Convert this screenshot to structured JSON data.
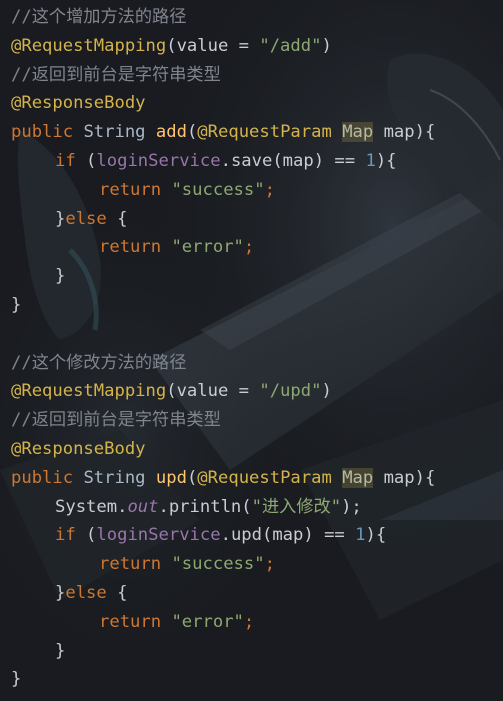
{
  "editor": {
    "lines": [
      {
        "indent": 0,
        "tokens": [
          {
            "t": "//这个增加方法的路径",
            "c": "cm"
          }
        ]
      },
      {
        "indent": 0,
        "tokens": [
          {
            "t": "@RequestMapping",
            "c": "an"
          },
          {
            "t": "(value = ",
            "c": "txt"
          },
          {
            "t": "\"/add\"",
            "c": "str"
          },
          {
            "t": ")",
            "c": "txt"
          }
        ]
      },
      {
        "indent": 0,
        "tokens": [
          {
            "t": "//返回到前台是字符串类型",
            "c": "cm"
          }
        ]
      },
      {
        "indent": 0,
        "tokens": [
          {
            "t": "@ResponseBody",
            "c": "an"
          }
        ]
      },
      {
        "indent": 0,
        "tokens": [
          {
            "t": "public",
            "c": "kw"
          },
          {
            "t": " String ",
            "c": "ty"
          },
          {
            "t": "add",
            "c": "fn"
          },
          {
            "t": "(",
            "c": "txt"
          },
          {
            "t": "@RequestParam",
            "c": "an"
          },
          {
            "t": " ",
            "c": "txt"
          },
          {
            "t": "Map",
            "c": "hl"
          },
          {
            "t": " map){",
            "c": "txt"
          }
        ]
      },
      {
        "indent": 1,
        "tokens": [
          {
            "t": "if",
            "c": "kw"
          },
          {
            "t": " (",
            "c": "txt"
          },
          {
            "t": "loginService",
            "c": "fld"
          },
          {
            "t": ".save(map) == ",
            "c": "txt"
          },
          {
            "t": "1",
            "c": "num"
          },
          {
            "t": "){",
            "c": "txt"
          }
        ]
      },
      {
        "indent": 2,
        "tokens": [
          {
            "t": "return",
            "c": "kw"
          },
          {
            "t": " ",
            "c": "txt"
          },
          {
            "t": "\"success\"",
            "c": "str"
          },
          {
            "t": ";",
            "c": "kw"
          }
        ]
      },
      {
        "indent": 1,
        "tokens": [
          {
            "t": "}",
            "c": "txt"
          },
          {
            "t": "else",
            "c": "kw"
          },
          {
            "t": " {",
            "c": "txt"
          }
        ]
      },
      {
        "indent": 2,
        "tokens": [
          {
            "t": "return",
            "c": "kw"
          },
          {
            "t": " ",
            "c": "txt"
          },
          {
            "t": "\"error\"",
            "c": "str"
          },
          {
            "t": ";",
            "c": "kw"
          }
        ]
      },
      {
        "indent": 1,
        "tokens": [
          {
            "t": "}",
            "c": "txt"
          }
        ]
      },
      {
        "indent": 0,
        "tokens": [
          {
            "t": "}",
            "c": "txt"
          }
        ]
      },
      {
        "indent": 0,
        "tokens": []
      },
      {
        "indent": 0,
        "tokens": [
          {
            "t": "//这个修改方法的路径",
            "c": "cm"
          }
        ]
      },
      {
        "indent": 0,
        "tokens": [
          {
            "t": "@RequestMapping",
            "c": "an"
          },
          {
            "t": "(value = ",
            "c": "txt"
          },
          {
            "t": "\"/upd\"",
            "c": "str"
          },
          {
            "t": ")",
            "c": "txt"
          }
        ]
      },
      {
        "indent": 0,
        "tokens": [
          {
            "t": "//返回到前台是字符串类型",
            "c": "cm"
          }
        ]
      },
      {
        "indent": 0,
        "tokens": [
          {
            "t": "@ResponseBody",
            "c": "an"
          }
        ]
      },
      {
        "indent": 0,
        "tokens": [
          {
            "t": "public",
            "c": "kw"
          },
          {
            "t": " String ",
            "c": "ty"
          },
          {
            "t": "upd",
            "c": "fn"
          },
          {
            "t": "(",
            "c": "txt"
          },
          {
            "t": "@RequestParam",
            "c": "an"
          },
          {
            "t": " ",
            "c": "txt"
          },
          {
            "t": "Map",
            "c": "hl"
          },
          {
            "t": " map){",
            "c": "txt"
          }
        ]
      },
      {
        "indent": 1,
        "tokens": [
          {
            "t": "System.",
            "c": "txt"
          },
          {
            "t": "out",
            "c": "it"
          },
          {
            "t": ".println(",
            "c": "txt"
          },
          {
            "t": "\"进入修改\"",
            "c": "str"
          },
          {
            "t": ");",
            "c": "txt"
          }
        ]
      },
      {
        "indent": 1,
        "tokens": [
          {
            "t": "if",
            "c": "kw"
          },
          {
            "t": " (",
            "c": "txt"
          },
          {
            "t": "loginService",
            "c": "fld"
          },
          {
            "t": ".upd(map) == ",
            "c": "txt"
          },
          {
            "t": "1",
            "c": "num"
          },
          {
            "t": "){",
            "c": "txt"
          }
        ]
      },
      {
        "indent": 2,
        "tokens": [
          {
            "t": "return",
            "c": "kw"
          },
          {
            "t": " ",
            "c": "txt"
          },
          {
            "t": "\"success\"",
            "c": "str"
          },
          {
            "t": ";",
            "c": "kw"
          }
        ]
      },
      {
        "indent": 1,
        "tokens": [
          {
            "t": "}",
            "c": "txt"
          },
          {
            "t": "else",
            "c": "kw"
          },
          {
            "t": " {",
            "c": "txt"
          }
        ]
      },
      {
        "indent": 2,
        "tokens": [
          {
            "t": "return",
            "c": "kw"
          },
          {
            "t": " ",
            "c": "txt"
          },
          {
            "t": "\"error\"",
            "c": "str"
          },
          {
            "t": ";",
            "c": "kw"
          }
        ]
      },
      {
        "indent": 1,
        "tokens": [
          {
            "t": "}",
            "c": "txt"
          }
        ]
      },
      {
        "indent": 0,
        "tokens": [
          {
            "t": "}",
            "c": "txt"
          }
        ]
      }
    ]
  },
  "colors": {
    "background": "#1b1d22",
    "comment": "#7f848e",
    "annotation": "#d4b44a",
    "keyword": "#cc7832",
    "string": "#8da872",
    "number": "#6897bb",
    "method": "#ffc66d",
    "field": "#9876aa"
  }
}
